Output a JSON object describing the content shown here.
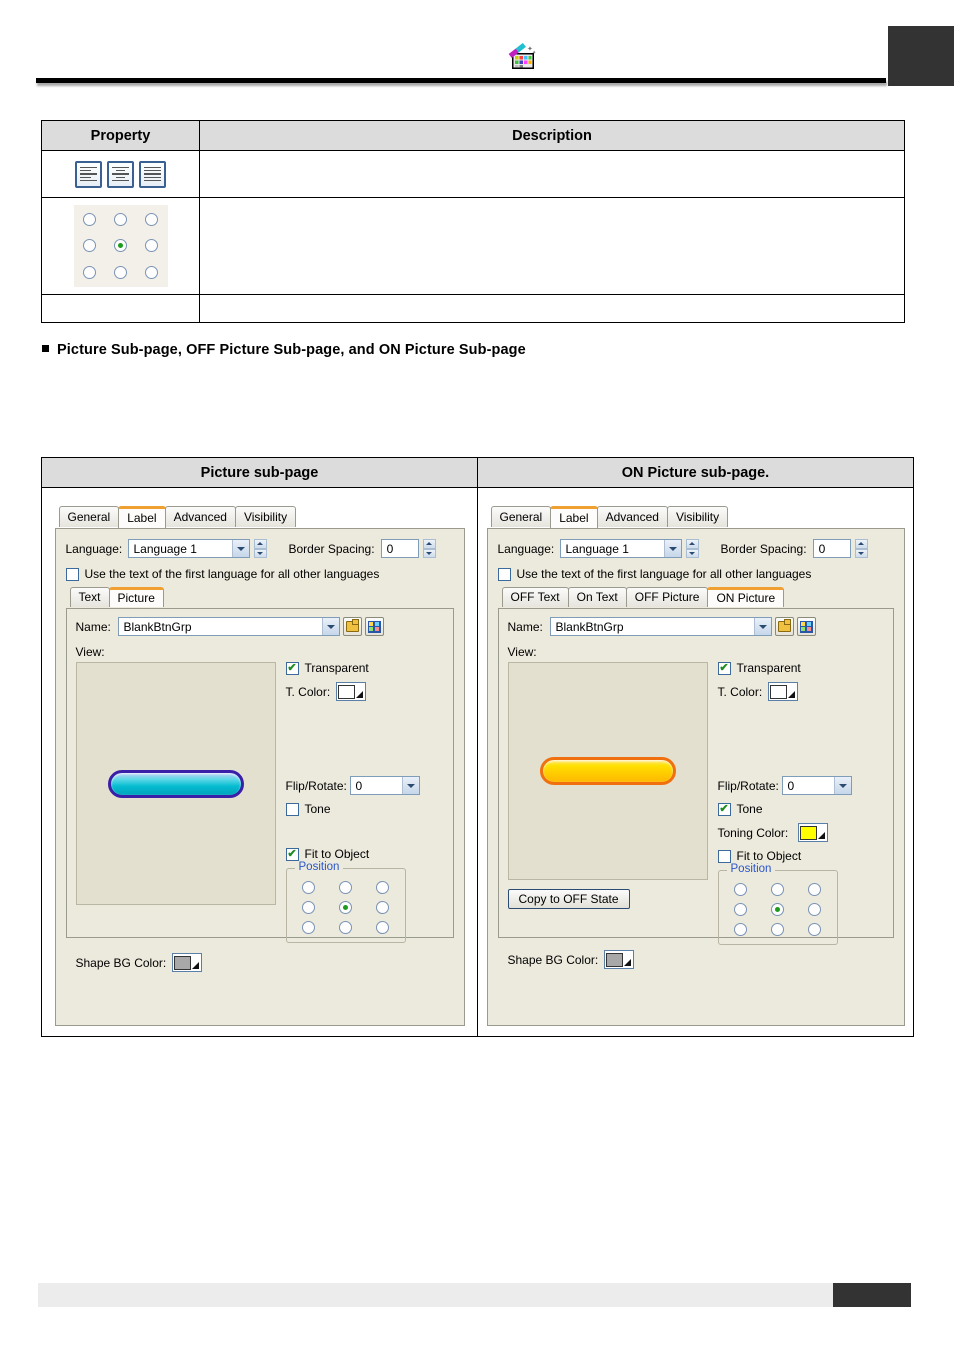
{
  "header": {
    "icon": "paint-palette-icon",
    "corner_block_color": "#333333"
  },
  "property_table": {
    "columns": [
      "Property",
      "Description"
    ],
    "rows": [
      {
        "property_type": "text-align-icons",
        "icons": [
          "align-left-icon",
          "align-center-icon",
          "align-justify-icon"
        ],
        "description": ""
      },
      {
        "property_type": "position-radio-grid",
        "selected": "center",
        "description": ""
      },
      {
        "property_type": "",
        "description": ""
      }
    ]
  },
  "bullet_heading": "Picture Sub-page, OFF Picture Sub-page, and ON Picture Sub-page",
  "shot_table": {
    "columns": [
      "Picture sub-page",
      "ON Picture sub-page."
    ]
  },
  "dialog_left": {
    "tabs": [
      {
        "label": "General",
        "selected": false
      },
      {
        "label": "Label",
        "selected": true
      },
      {
        "label": "Advanced",
        "selected": false
      },
      {
        "label": "Visibility",
        "selected": false
      }
    ],
    "language_label": "Language:",
    "language_value": "Language 1",
    "border_spacing_label": "Border Spacing:",
    "border_spacing_value": "0",
    "use_first_language_label": "Use the text of the first language for all other languages",
    "use_first_language_checked": false,
    "subtabs": [
      {
        "label": "Text",
        "selected": false
      },
      {
        "label": "Picture",
        "selected": true
      }
    ],
    "name_label": "Name:",
    "name_value": "BlankBtnGrp",
    "open_icon": "open-folder-icon",
    "library_icon": "picture-library-icon",
    "view_label": "View:",
    "preview_shape": "blue-rounded-button",
    "transparent_label": "Transparent",
    "transparent_checked": true,
    "t_color_label": "T. Color:",
    "t_color_swatch": "#ffffff",
    "flip_rotate_label": "Flip/Rotate:",
    "flip_rotate_value": "0",
    "tone_label": "Tone",
    "tone_checked": false,
    "fit_to_object_label": "Fit to Object",
    "fit_to_object_checked": true,
    "position_group_label": "Position",
    "position_selected_index": 4,
    "shape_bg_color_label": "Shape BG Color:",
    "shape_bg_color_swatch": "#a8a8a8"
  },
  "dialog_right": {
    "tabs": [
      {
        "label": "General",
        "selected": false
      },
      {
        "label": "Label",
        "selected": true
      },
      {
        "label": "Advanced",
        "selected": false
      },
      {
        "label": "Visibility",
        "selected": false
      }
    ],
    "language_label": "Language:",
    "language_value": "Language 1",
    "border_spacing_label": "Border Spacing:",
    "border_spacing_value": "0",
    "use_first_language_label": "Use the text of the first language for all other languages",
    "use_first_language_checked": false,
    "subtabs": [
      {
        "label": "OFF Text",
        "selected": false
      },
      {
        "label": "On Text",
        "selected": false
      },
      {
        "label": "OFF Picture",
        "selected": false
      },
      {
        "label": "ON Picture",
        "selected": true
      }
    ],
    "name_label": "Name:",
    "name_value": "BlankBtnGrp",
    "open_icon": "open-folder-icon",
    "library_icon": "picture-library-icon",
    "view_label": "View:",
    "preview_shape": "yellow-rounded-button",
    "transparent_label": "Transparent",
    "transparent_checked": true,
    "t_color_label": "T. Color:",
    "t_color_swatch": "#ffffff",
    "flip_rotate_label": "Flip/Rotate:",
    "flip_rotate_value": "0",
    "tone_label": "Tone",
    "tone_checked": true,
    "toning_color_label": "Toning Color:",
    "toning_color_swatch": "#ffff00",
    "fit_to_object_label": "Fit to Object",
    "fit_to_object_checked": false,
    "copy_to_off_state_label": "Copy to OFF State",
    "position_group_label": "Position",
    "position_selected_index": 4,
    "shape_bg_color_label": "Shape BG Color:",
    "shape_bg_color_swatch": "#a8a8a8"
  },
  "footer": {
    "bar_color": "#ececec",
    "block_color": "#333333"
  }
}
